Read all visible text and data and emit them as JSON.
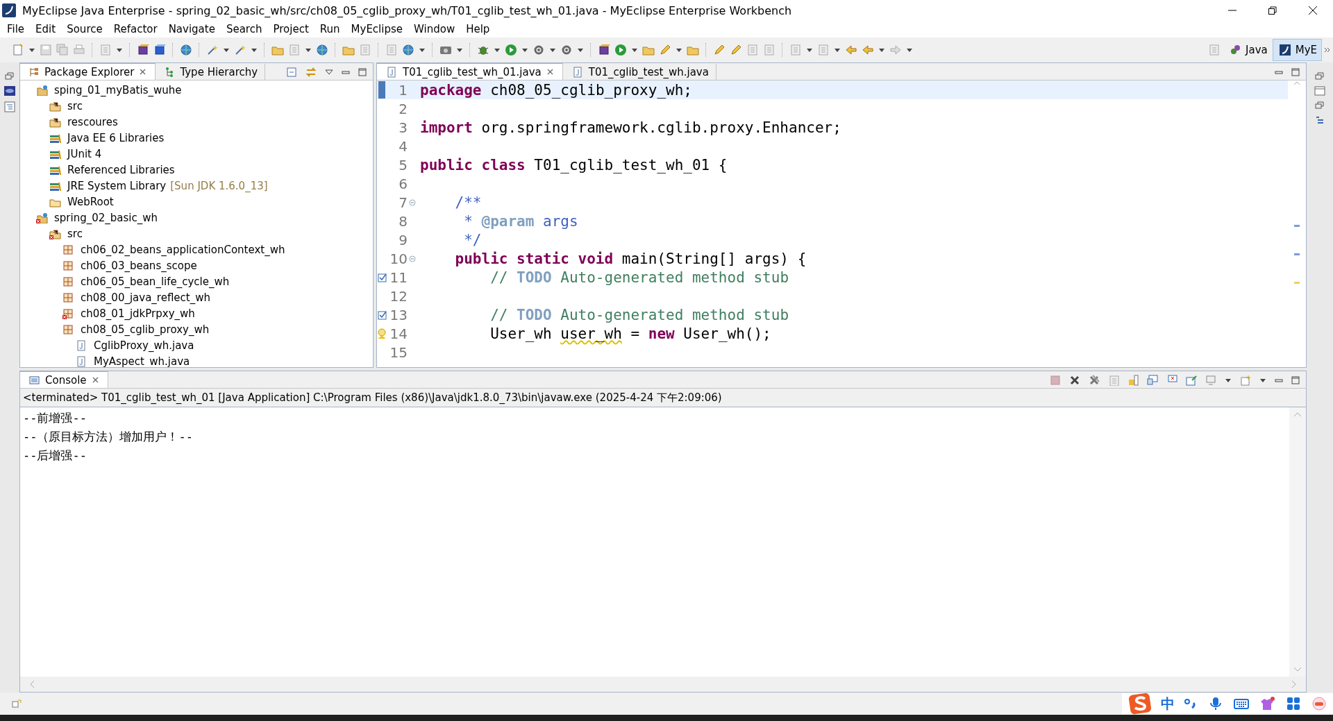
{
  "window": {
    "title": "MyEclipse Java Enterprise - spring_02_basic_wh/src/ch08_05_cglib_proxy_wh/T01_cglib_test_wh_01.java - MyEclipse Enterprise Workbench"
  },
  "menu": [
    "File",
    "Edit",
    "Source",
    "Refactor",
    "Navigate",
    "Search",
    "Project",
    "Run",
    "MyEclipse",
    "Window",
    "Help"
  ],
  "perspectives": [
    {
      "label": "Java",
      "selected": false
    },
    {
      "label": "MyE",
      "selected": true
    }
  ],
  "explorer": {
    "tabs": [
      {
        "label": "Package Explorer",
        "selected": true
      },
      {
        "label": "Type Hierarchy",
        "selected": false
      }
    ],
    "tree": [
      {
        "kind": "project",
        "label": "sping_01_myBatis_wuhe",
        "error": false,
        "children": [
          {
            "kind": "source_folder",
            "label": "src",
            "error": false
          },
          {
            "kind": "source_folder",
            "label": "rescoures",
            "error": false
          },
          {
            "kind": "library",
            "label": "Java EE 6 Libraries",
            "error": false
          },
          {
            "kind": "library",
            "label": "JUnit 4",
            "error": false
          },
          {
            "kind": "library",
            "label": "Referenced Libraries",
            "error": false
          },
          {
            "kind": "library",
            "label": "JRE System Library",
            "decoration": "[Sun JDK 1.6.0_13]",
            "error": false
          },
          {
            "kind": "folder",
            "label": "WebRoot",
            "error": false
          }
        ]
      },
      {
        "kind": "project",
        "label": "spring_02_basic_wh",
        "error": true,
        "children": [
          {
            "kind": "source_folder",
            "label": "src",
            "error": true,
            "children": [
              {
                "kind": "package",
                "label": "ch06_02_beans_applicationContext_wh",
                "error": false
              },
              {
                "kind": "package",
                "label": "ch06_03_beans_scope",
                "error": false
              },
              {
                "kind": "package",
                "label": "ch06_05_bean_life_cycle_wh",
                "error": false
              },
              {
                "kind": "package",
                "label": "ch08_00_java_reflect_wh",
                "error": false
              },
              {
                "kind": "package",
                "label": "ch08_01_jdkPrpxy_wh",
                "error": true
              },
              {
                "kind": "package",
                "label": "ch08_05_cglib_proxy_wh",
                "error": false,
                "children": [
                  {
                    "kind": "file",
                    "label": "CglibProxy_wh.java",
                    "error": false
                  },
                  {
                    "kind": "file",
                    "label": "MyAspect_wh.java",
                    "error": false
                  }
                ]
              }
            ]
          }
        ]
      }
    ]
  },
  "editor": {
    "tabs": [
      {
        "label": "T01_cglib_test_wh_01.java",
        "selected": true
      },
      {
        "label": "T01_cglib_test_wh.java",
        "selected": false
      }
    ],
    "lines": [
      {
        "number": "1",
        "current": true,
        "fold": false,
        "task": false,
        "warning": false,
        "tokens": [
          {
            "kind": "keyword",
            "text": "package"
          },
          {
            "kind": "plain",
            "text": " ch08_05_cglib_proxy_wh;"
          }
        ]
      },
      {
        "number": "2",
        "current": false,
        "fold": false,
        "task": false,
        "warning": false
      },
      {
        "number": "3",
        "current": false,
        "fold": false,
        "task": false,
        "warning": false,
        "tokens": [
          {
            "kind": "keyword",
            "text": "import"
          },
          {
            "kind": "plain",
            "text": " org.springframework.cglib.proxy.Enhancer;"
          }
        ]
      },
      {
        "number": "4",
        "current": false,
        "fold": false,
        "task": false,
        "warning": false
      },
      {
        "number": "5",
        "current": false,
        "fold": false,
        "task": false,
        "warning": false,
        "tokens": [
          {
            "kind": "keyword",
            "text": "public class"
          },
          {
            "kind": "plain",
            "text": " T01_cglib_test_wh_01 {"
          }
        ]
      },
      {
        "number": "6",
        "current": false,
        "fold": false,
        "task": false,
        "warning": false
      },
      {
        "number": "7",
        "current": false,
        "fold": true,
        "task": false,
        "warning": false,
        "tokens": [
          {
            "kind": "javadoc",
            "text": "    /**"
          }
        ]
      },
      {
        "number": "8",
        "current": false,
        "fold": false,
        "task": false,
        "warning": false,
        "tokens": [
          {
            "kind": "javadoc",
            "text": "     * "
          },
          {
            "kind": "javadoc_tag",
            "text": "@param"
          },
          {
            "kind": "javadoc",
            "text": " args"
          }
        ]
      },
      {
        "number": "9",
        "current": false,
        "fold": false,
        "task": false,
        "warning": false,
        "tokens": [
          {
            "kind": "javadoc",
            "text": "     */"
          }
        ]
      },
      {
        "number": "10",
        "current": false,
        "fold": true,
        "task": false,
        "warning": false,
        "tokens": [
          {
            "kind": "keyword",
            "text": "    public static void"
          },
          {
            "kind": "plain",
            "text": " main(String[] args) {"
          }
        ]
      },
      {
        "number": "11",
        "current": false,
        "fold": false,
        "task": true,
        "warning": false,
        "tokens": [
          {
            "kind": "comment",
            "text": "        // "
          },
          {
            "kind": "task_tag",
            "text": "TODO"
          },
          {
            "kind": "comment",
            "text": " Auto-generated method stub"
          }
        ]
      },
      {
        "number": "12",
        "current": false,
        "fold": false,
        "task": false,
        "warning": false
      },
      {
        "number": "13",
        "current": false,
        "fold": false,
        "task": true,
        "warning": false,
        "tokens": [
          {
            "kind": "comment",
            "text": "        // "
          },
          {
            "kind": "task_tag",
            "text": "TODO"
          },
          {
            "kind": "comment",
            "text": " Auto-generated method stub"
          }
        ]
      },
      {
        "number": "14",
        "current": false,
        "fold": false,
        "task": false,
        "warning": true,
        "tokens": [
          {
            "kind": "plain",
            "text": "        User_wh "
          },
          {
            "kind": "warning",
            "text": "user_wh"
          },
          {
            "kind": "plain",
            "text": " = "
          },
          {
            "kind": "keyword",
            "text": "new"
          },
          {
            "kind": "plain",
            "text": " User_wh();"
          }
        ]
      },
      {
        "number": "15",
        "current": false,
        "fold": false,
        "task": false,
        "warning": false
      }
    ]
  },
  "console": {
    "tab": "Console",
    "header": "<terminated> T01_cglib_test_wh_01 [Java Application] C:\\Program Files (x86)\\Java\\jdk1.8.0_73\\bin\\javaw.exe (2025-4-24 下午2:09:06)",
    "output": [
      "--前增强--",
      "--（原目标方法）增加用户！--",
      "--后增强--"
    ]
  },
  "ime": {
    "mode": "中"
  }
}
